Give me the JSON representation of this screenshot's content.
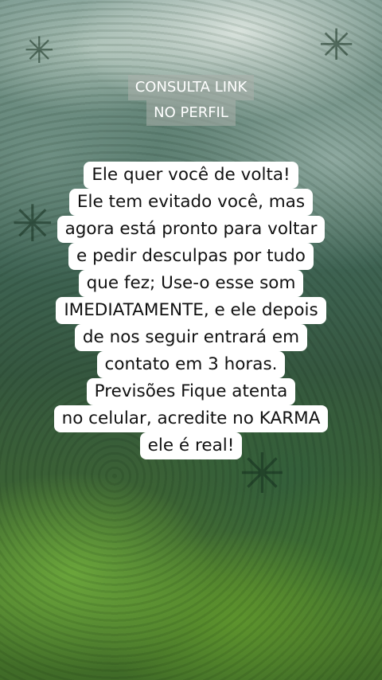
{
  "overlay": {
    "lines": [
      "CONSULTA LINK",
      "NO PERFIL"
    ]
  },
  "caption": {
    "lines": [
      "Ele quer você de volta!",
      "Ele tem evitado você, mas",
      "agora está pronto para voltar",
      "e pedir desculpas por tudo",
      "que fez; Use-o esse som",
      "IMEDIATAMENTE, e ele depois",
      "de nos seguir entrará em",
      "contato em 3 horas.",
      "Previsões Fique atenta",
      "no celular, acredite no KARMA",
      "ele é real!"
    ]
  },
  "colors": {
    "caption_bg": "#ffffff",
    "caption_text": "#111111",
    "overlay_text": "#ffffff"
  }
}
